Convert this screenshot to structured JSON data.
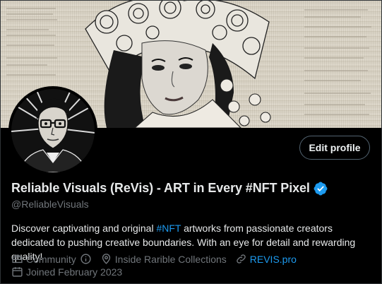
{
  "profile": {
    "display_name": "Reliable Visuals (ReVis) - ART in Every #NFT Pixel",
    "handle": "@ReliableVisuals",
    "edit_label": "Edit profile",
    "bio": {
      "before": "Discover captivating and original ",
      "hashtag": "#NFT",
      "after": " artworks from passionate creators dedicated to pushing creative boundaries. With an eye for detail and rewarding quality!"
    },
    "meta": {
      "category": "Community",
      "location": "Inside Rarible Collections",
      "website": "REVIS.pro",
      "joined": "Joined February 2023"
    }
  },
  "icons": {
    "verified": "verified-badge-icon",
    "category": "briefcase-icon",
    "info": "info-icon",
    "location": "location-pin-icon",
    "link": "link-icon",
    "calendar": "calendar-icon"
  },
  "colors": {
    "background": "#000000",
    "text": "#e7e9ea",
    "muted": "#71767b",
    "accent": "#1d9bf0"
  }
}
